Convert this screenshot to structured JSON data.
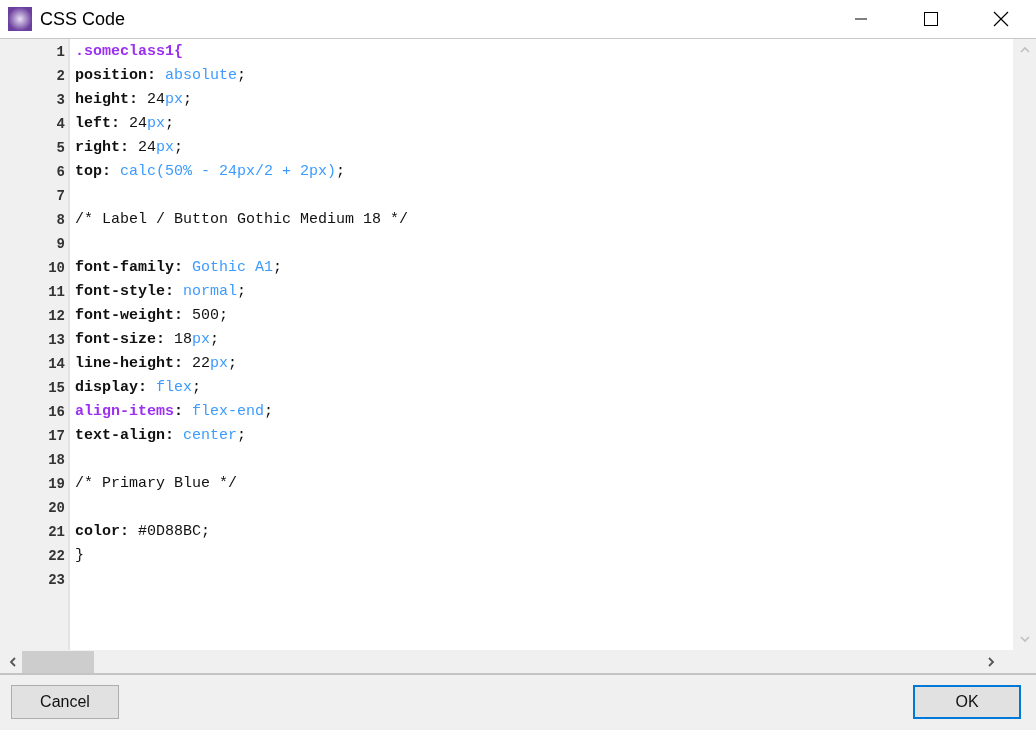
{
  "window": {
    "title": "CSS Code"
  },
  "editor": {
    "lines": [
      {
        "number": "1",
        "tokens": [
          {
            "kind": "selector",
            "text": ".someclass1{"
          }
        ]
      },
      {
        "number": "2",
        "tokens": [
          {
            "kind": "property",
            "text": "position:"
          },
          {
            "kind": "value",
            "text": " absolute"
          },
          {
            "kind": "plain",
            "text": ";"
          }
        ]
      },
      {
        "number": "3",
        "tokens": [
          {
            "kind": "property",
            "text": "height:"
          },
          {
            "kind": "plain",
            "text": " 24"
          },
          {
            "kind": "value",
            "text": "px"
          },
          {
            "kind": "plain",
            "text": ";"
          }
        ]
      },
      {
        "number": "4",
        "tokens": [
          {
            "kind": "property",
            "text": "left:"
          },
          {
            "kind": "plain",
            "text": " 24"
          },
          {
            "kind": "value",
            "text": "px"
          },
          {
            "kind": "plain",
            "text": ";"
          }
        ]
      },
      {
        "number": "5",
        "tokens": [
          {
            "kind": "property",
            "text": "right:"
          },
          {
            "kind": "plain",
            "text": " 24"
          },
          {
            "kind": "value",
            "text": "px"
          },
          {
            "kind": "plain",
            "text": ";"
          }
        ]
      },
      {
        "number": "6",
        "tokens": [
          {
            "kind": "property",
            "text": "top:"
          },
          {
            "kind": "value",
            "text": " calc(50% - 24px/2 + 2px)"
          },
          {
            "kind": "plain",
            "text": ";"
          }
        ]
      },
      {
        "number": "7"
      },
      {
        "number": "8",
        "tokens": [
          {
            "kind": "plain",
            "text": "/* Label / Button Gothic Medium 18 */"
          }
        ]
      },
      {
        "number": "9"
      },
      {
        "number": "10",
        "tokens": [
          {
            "kind": "property",
            "text": "font-family:"
          },
          {
            "kind": "value",
            "text": " Gothic A1"
          },
          {
            "kind": "plain",
            "text": ";"
          }
        ]
      },
      {
        "number": "11",
        "tokens": [
          {
            "kind": "property",
            "text": "font-style:"
          },
          {
            "kind": "value",
            "text": " normal"
          },
          {
            "kind": "plain",
            "text": ";"
          }
        ]
      },
      {
        "number": "12",
        "tokens": [
          {
            "kind": "property",
            "text": "font-weight:"
          },
          {
            "kind": "plain",
            "text": " 500;"
          }
        ]
      },
      {
        "number": "13",
        "tokens": [
          {
            "kind": "property",
            "text": "font-size:"
          },
          {
            "kind": "plain",
            "text": " 18"
          },
          {
            "kind": "value",
            "text": "px"
          },
          {
            "kind": "plain",
            "text": ";"
          }
        ]
      },
      {
        "number": "14",
        "tokens": [
          {
            "kind": "property",
            "text": "line-height:"
          },
          {
            "kind": "plain",
            "text": " 22"
          },
          {
            "kind": "value",
            "text": "px"
          },
          {
            "kind": "plain",
            "text": ";"
          }
        ]
      },
      {
        "number": "15",
        "tokens": [
          {
            "kind": "property",
            "text": "display:"
          },
          {
            "kind": "value",
            "text": " flex"
          },
          {
            "kind": "plain",
            "text": ";"
          }
        ]
      },
      {
        "number": "16",
        "tokens": [
          {
            "kind": "selector",
            "text": "align-items"
          },
          {
            "kind": "property",
            "text": ":"
          },
          {
            "kind": "value",
            "text": " flex-end"
          },
          {
            "kind": "plain",
            "text": ";"
          }
        ]
      },
      {
        "number": "17",
        "tokens": [
          {
            "kind": "property",
            "text": "text-align:"
          },
          {
            "kind": "value",
            "text": " center"
          },
          {
            "kind": "plain",
            "text": ";"
          }
        ]
      },
      {
        "number": "18"
      },
      {
        "number": "19",
        "tokens": [
          {
            "kind": "plain",
            "text": "/* Primary Blue */"
          }
        ]
      },
      {
        "number": "20"
      },
      {
        "number": "21",
        "tokens": [
          {
            "kind": "property",
            "text": "color:"
          },
          {
            "kind": "plain",
            "text": " #0D88BC;"
          }
        ]
      },
      {
        "number": "22",
        "tokens": [
          {
            "kind": "plain",
            "text": "}"
          }
        ]
      },
      {
        "number": "23"
      }
    ]
  },
  "buttons": [
    {
      "label": "Cancel",
      "default": false
    },
    {
      "label": "OK",
      "default": true
    }
  ]
}
